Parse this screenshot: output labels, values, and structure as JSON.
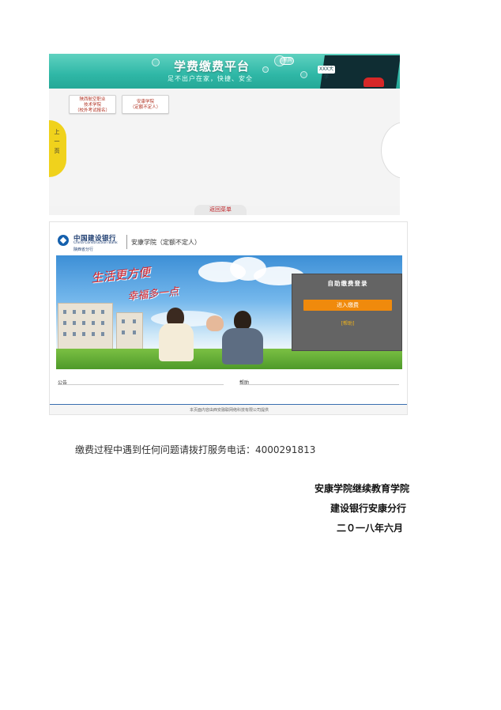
{
  "platform_screenshot": {
    "banner_title": "学费缴费平台",
    "banner_subtitle": "足不出户在家，快捷、安全",
    "bank_badge": "i黑网",
    "cap_label": "XXX大学",
    "schools": [
      {
        "lines": [
          "陕西航空职业",
          "技术学院",
          "（校外考试报名）"
        ]
      },
      {
        "lines": [
          "安康学院",
          "（定额不定人）"
        ]
      }
    ],
    "prev_page": [
      "上",
      "一",
      "页"
    ],
    "back_menu": "返回菜单"
  },
  "ccb_screenshot": {
    "bank_name_cn": "中国建设银行",
    "bank_name_en": "China Construction Bank",
    "bank_branch": "陕西省分行",
    "school_label": "安康学院（定额不定人）",
    "slogan_1": "生活更方便",
    "slogan_2": "幸福多一点",
    "login_title": "自助缴费登录",
    "login_button": "进入缴费",
    "login_help": "[帮助]",
    "notice_label": "公告",
    "help_label": "帮助",
    "footer_text": "本页面内容由西安融联网络科技有限公司提供"
  },
  "document": {
    "hotline": "缴费过程中遇到任何问题请拨打服务电话：4000291813",
    "signature": {
      "line1": "安康学院继续教育学院",
      "line2": "建设银行安康分行",
      "line3": "二０一八年六月"
    }
  }
}
